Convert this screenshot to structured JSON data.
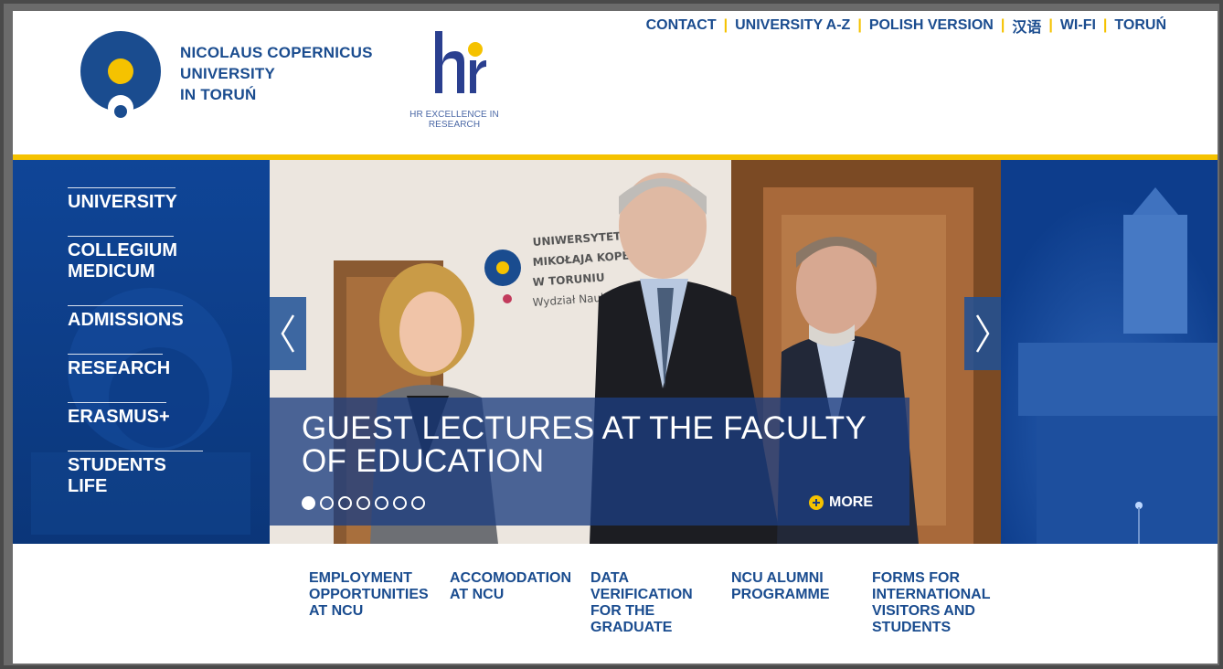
{
  "site": {
    "logo_lines": [
      "NICOLAUS COPERNICUS",
      "UNIVERSITY",
      "IN TORUŃ"
    ],
    "hr_caption": "HR EXCELLENCE IN RESEARCH"
  },
  "top_nav": [
    {
      "label": "CONTACT"
    },
    {
      "label": "UNIVERSITY A-Z"
    },
    {
      "label": "POLISH VERSION"
    },
    {
      "label": "汉语"
    },
    {
      "label": "WI-FI"
    },
    {
      "label": "TORUŃ"
    }
  ],
  "side_nav": [
    {
      "lines": [
        "UNIVERSITY"
      ]
    },
    {
      "lines": [
        "COLLEGIUM",
        "MEDICUM"
      ]
    },
    {
      "lines": [
        "ADMISSIONS"
      ]
    },
    {
      "lines": [
        "RESEARCH"
      ]
    },
    {
      "lines": [
        "ERASMUS+"
      ]
    },
    {
      "lines": [
        "STUDENTS LIFE"
      ]
    }
  ],
  "slider": {
    "title": "GUEST LECTURES AT THE FACULTY OF EDUCATION",
    "more_label": "MORE",
    "dot_count": 7,
    "active_dot": 1,
    "sign_text": [
      "UNIWERSYTET",
      "MIKOŁAJA KOPERN",
      "W TORUNIU",
      "Wydział Nauk Ped"
    ]
  },
  "quick_links": [
    {
      "lines": [
        "EMPLOYMENT",
        "OPPORTUNITIES",
        "AT NCU"
      ]
    },
    {
      "lines": [
        "ACCOMODATION",
        "AT NCU"
      ]
    },
    {
      "lines": [
        "DATA",
        "VERIFICATION",
        "FOR THE",
        "GRADUATE"
      ]
    },
    {
      "lines": [
        "NCU ALUMNI",
        "PROGRAMME"
      ]
    },
    {
      "lines": [
        "FORMS FOR",
        "INTERNATIONAL",
        "VISITORS AND",
        "STUDENTS"
      ]
    }
  ],
  "colors": {
    "brand_blue": "#1a4c8f",
    "gold": "#f5c200",
    "hero_blue": "#0e3f8f"
  }
}
